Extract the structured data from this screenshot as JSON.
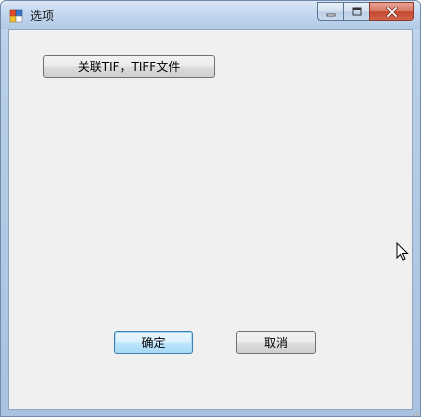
{
  "window": {
    "title": "选项",
    "icon": "app-icon",
    "controls": {
      "minimize_icon": "minimize-icon",
      "maximize_icon": "maximize-icon",
      "close_icon": "close-icon"
    }
  },
  "form": {
    "associate_button_label": "关联TIF，TIFF文件",
    "ok_button_label": "确定",
    "cancel_button_label": "取消"
  },
  "colors": {
    "client_background": "#f0f0f0",
    "close_button": "#c4492f",
    "default_button_border": "#3c7fb1"
  }
}
